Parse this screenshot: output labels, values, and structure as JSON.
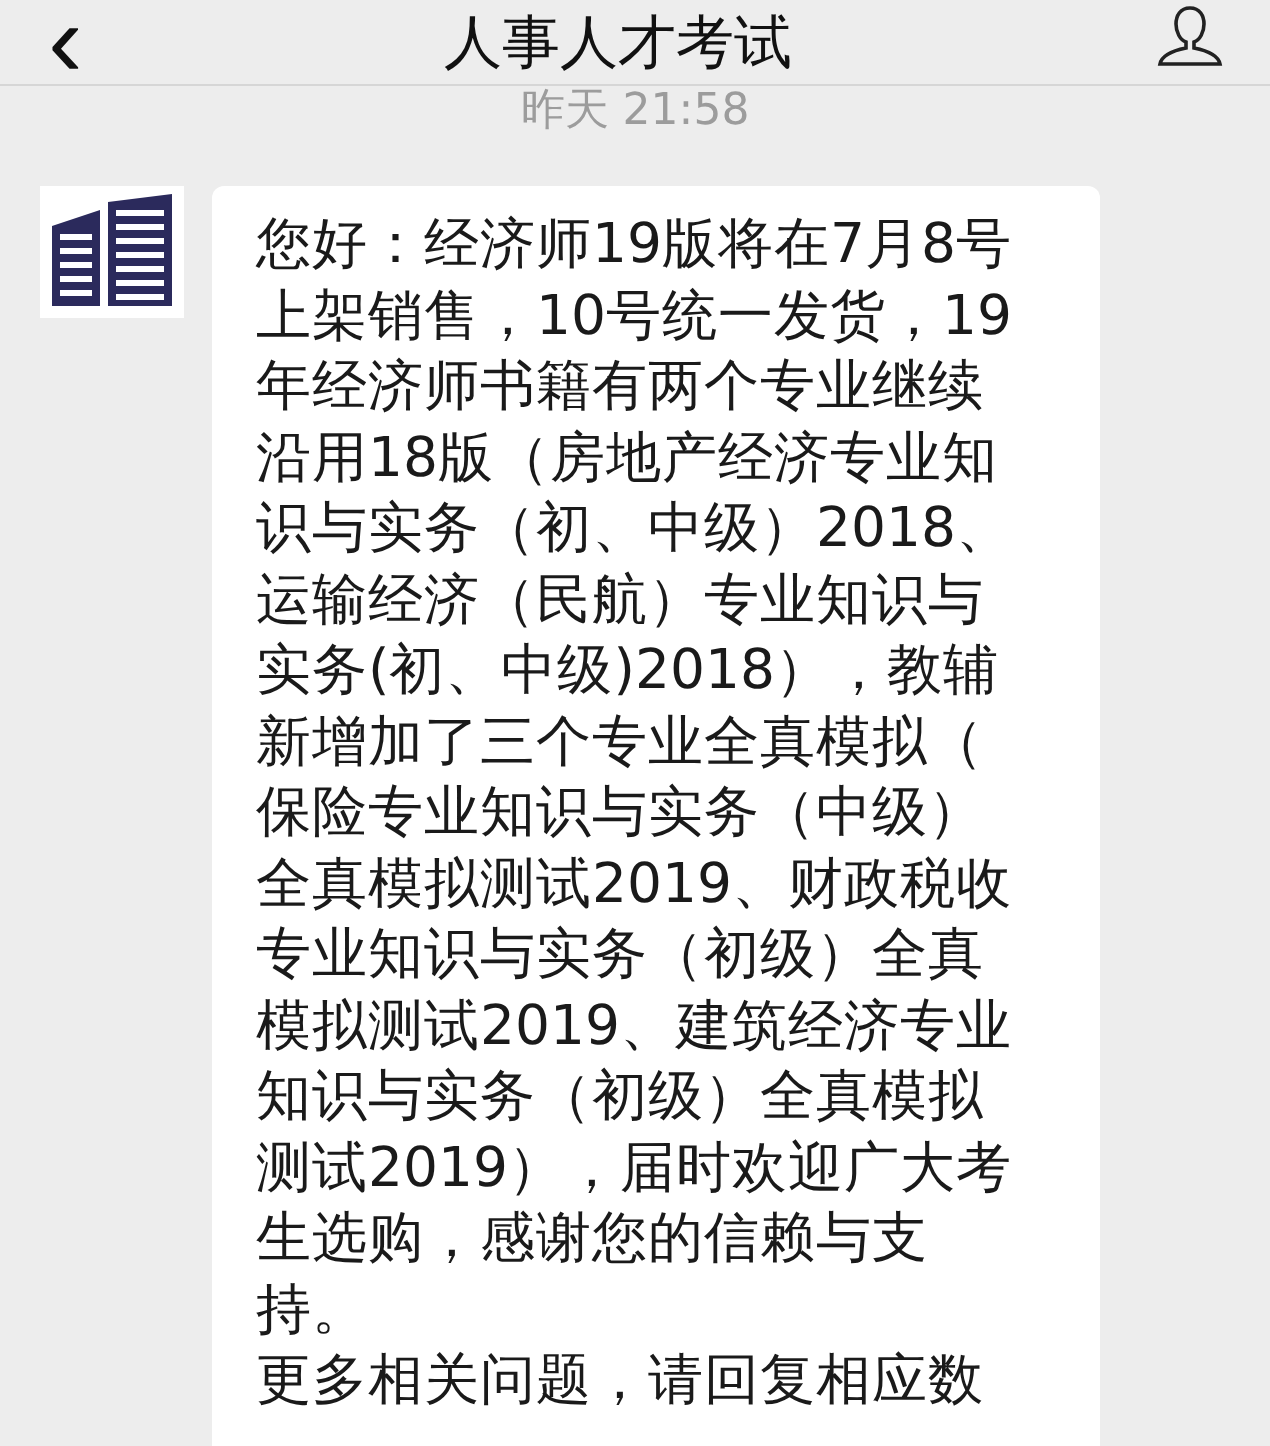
{
  "header": {
    "title": "人事人才考试",
    "back": "‹"
  },
  "time": "昨天 21:58",
  "message": {
    "lines": [
      "您好：经济师19版将在7月8号",
      "上架销售，10号统一发货，19",
      "年经济师书籍有两个专业继续",
      "沿用18版（房地产经济专业知",
      "识与实务（初、中级）2018、",
      "运输经济（民航）专业知识与",
      "实务(初、中级)2018），教辅",
      "新增加了三个专业全真模拟（",
      "保险专业知识与实务（中级）",
      "全真模拟测试2019、财政税收",
      "专业知识与实务（初级）全真",
      "模拟测试2019、建筑经济专业",
      "知识与实务（初级）全真模拟",
      "测试2019），届时欢迎广大考",
      "生选购，感谢您的信赖与支",
      "持。",
      "更多相关问题，请回复相应数"
    ]
  }
}
